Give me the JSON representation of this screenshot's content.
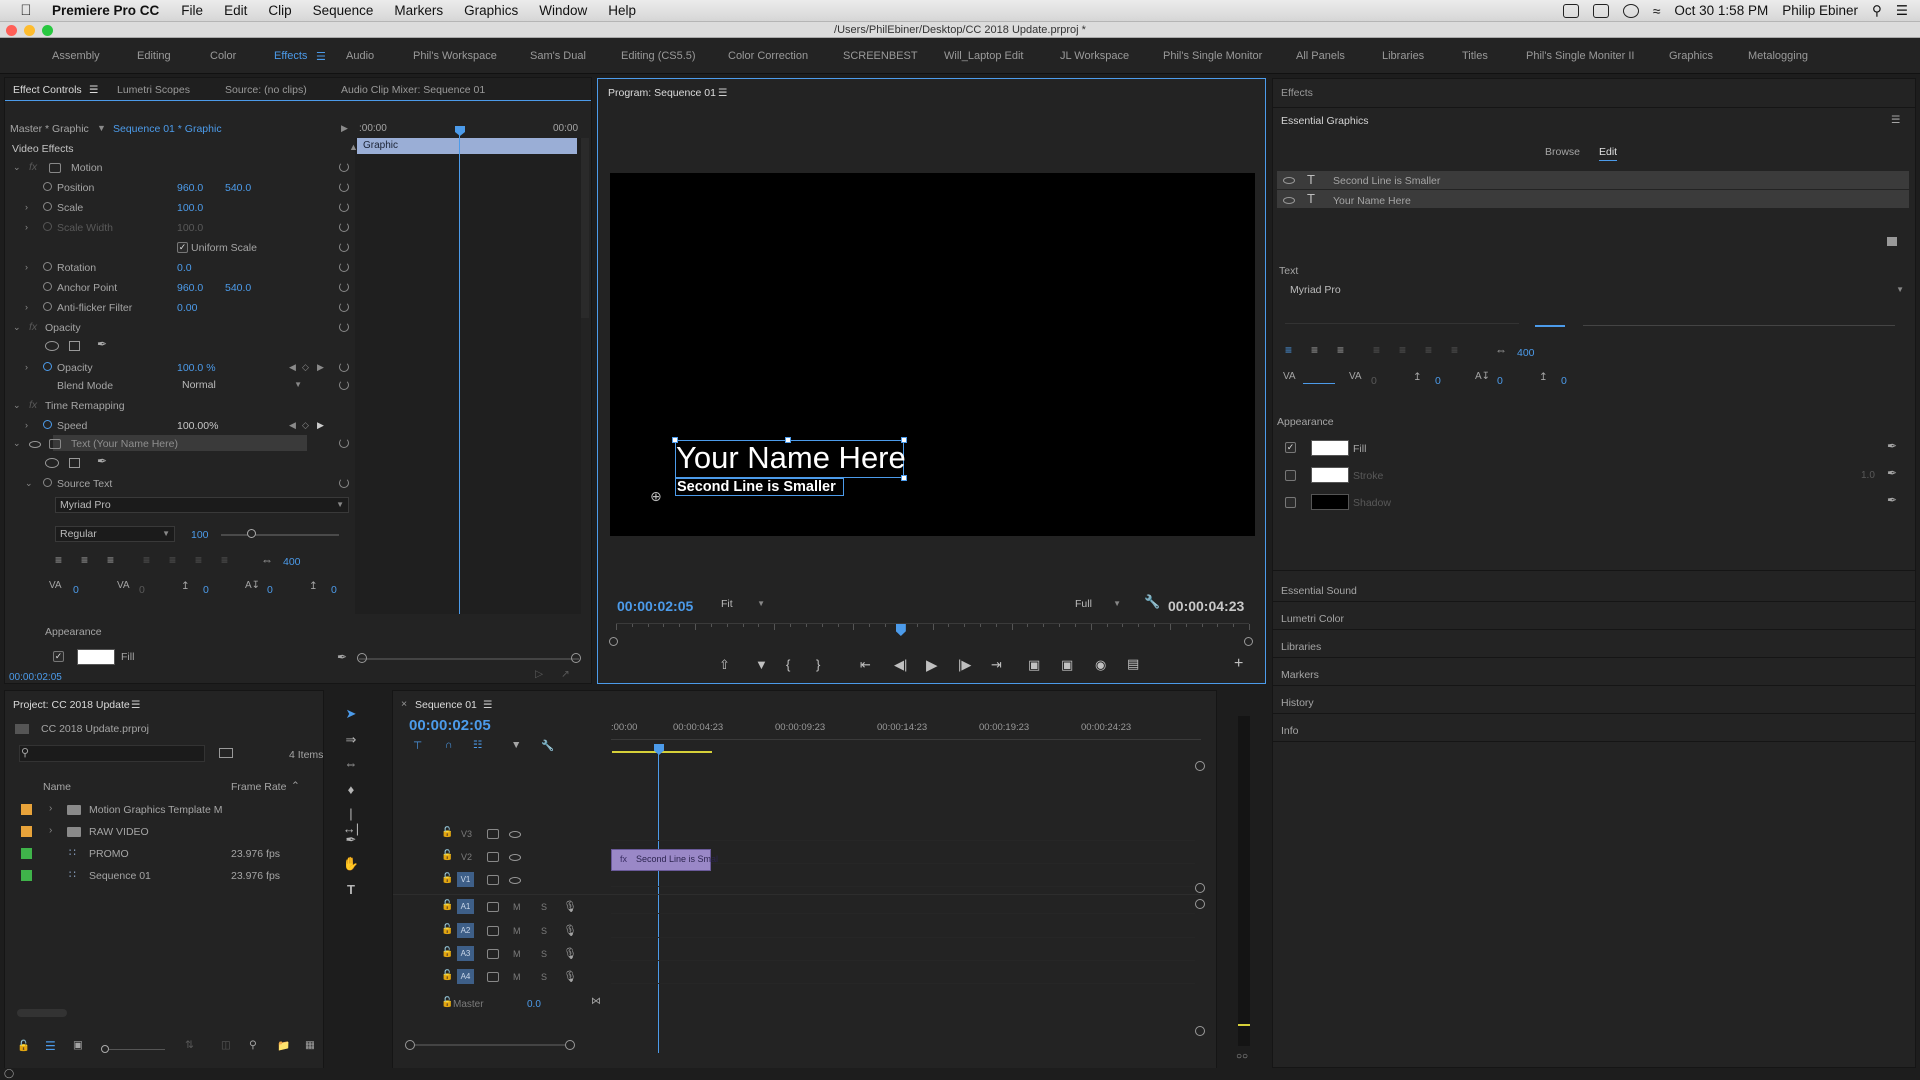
{
  "menubar": {
    "app": "Premiere Pro CC",
    "menus": [
      "File",
      "Edit",
      "Clip",
      "Sequence",
      "Markers",
      "Graphics",
      "Window",
      "Help"
    ],
    "datetime": "Oct 30  1:58 PM",
    "user": "Philip Ebiner"
  },
  "window_title": "/Users/PhilEbiner/Desktop/CC 2018 Update.prproj *",
  "workspaces": [
    "Assembly",
    "Editing",
    "Color",
    "Effects",
    "Audio",
    "Phil's Workspace",
    "Sam's Dual",
    "Editing (CS5.5)",
    "Color Correction",
    "SCREENBEST",
    "Will_Laptop Edit",
    "JL Workspace",
    "Phil's Single Monitor",
    "All Panels",
    "Libraries",
    "Titles",
    "Phil's Single Moniter II",
    "Graphics",
    "Metalogging"
  ],
  "active_workspace": "Effects",
  "effect_controls": {
    "tabs": [
      "Effect Controls",
      "Lumetri Scopes",
      "Source: (no clips)",
      "Audio Clip Mixer: Sequence 01"
    ],
    "master": "Master * Graphic",
    "sequence": "Sequence 01 * Graphic",
    "time_start": ":00:00",
    "time_end": "00:00",
    "clip_label": "Graphic",
    "video_effects": "Video Effects",
    "motion": "Motion",
    "position_label": "Position",
    "position_x": "960.0",
    "position_y": "540.0",
    "scale_label": "Scale",
    "scale": "100.0",
    "scale_width_label": "Scale Width",
    "scale_width": "100.0",
    "uniform_scale": "Uniform Scale",
    "rotation_label": "Rotation",
    "rotation": "0.0",
    "anchor_label": "Anchor Point",
    "anchor_x": "960.0",
    "anchor_y": "540.0",
    "antiflicker_label": "Anti-flicker Filter",
    "antiflicker": "0.00",
    "opacity_group": "Opacity",
    "opacity_label": "Opacity",
    "opacity": "100.0 %",
    "blend_label": "Blend Mode",
    "blend": "Normal",
    "time_remap": "Time Remapping",
    "speed_label": "Speed",
    "speed": "100.00%",
    "text_layer": "Text (Your Name Here)",
    "source_text": "Source Text",
    "font": "Myriad Pro",
    "font_style": "Regular",
    "font_size": "100",
    "tracking_val": "400",
    "kerning_vals": [
      "0",
      "0",
      "0",
      "0",
      "0"
    ],
    "appearance": "Appearance",
    "fill": "Fill",
    "timecode": "00:00:02:05"
  },
  "program_monitor": {
    "title": "Program: Sequence 01",
    "title_line1": "Your Name Here",
    "title_line2": "Second Line is Smaller",
    "timecode": "00:00:02:05",
    "fit": "Fit",
    "quality": "Full",
    "duration": "00:00:04:23",
    "playhead_fraction": 0.45
  },
  "essential_graphics": {
    "effects_tab": "Effects",
    "title": "Essential Graphics",
    "browse": "Browse",
    "edit": "Edit",
    "layers": [
      "Second Line is Smaller",
      "Your Name Here"
    ],
    "text_section": "Text",
    "font": "Myriad Pro",
    "tracking": "400",
    "kerning_vals": [
      "0",
      "0",
      "0",
      "0"
    ],
    "appearance": "Appearance",
    "fill": "Fill",
    "stroke": "Stroke",
    "stroke_width": "1.0",
    "shadow": "Shadow",
    "collapsed_panels": [
      "Essential Sound",
      "Lumetri Color",
      "Libraries",
      "Markers",
      "History",
      "Info"
    ]
  },
  "project": {
    "title": "Project: CC 2018 Update",
    "file": "CC 2018 Update.prproj",
    "items_count": "4 Items",
    "col_name": "Name",
    "col_fps": "Frame Rate",
    "items": [
      {
        "name": "Motion Graphics Template M",
        "fps": "",
        "color": "#e8a33a",
        "type": "folder"
      },
      {
        "name": "RAW VIDEO",
        "fps": "",
        "color": "#e8a33a",
        "type": "folder"
      },
      {
        "name": "PROMO",
        "fps": "23.976 fps",
        "color": "#3fb34a",
        "type": "seq"
      },
      {
        "name": "Sequence 01",
        "fps": "23.976 fps",
        "color": "#3fb34a",
        "type": "seq"
      }
    ]
  },
  "timeline": {
    "tab": "Sequence 01",
    "timecode": "00:00:02:05",
    "ruler": [
      ":00:00",
      "00:00:04:23",
      "00:00:09:23",
      "00:00:14:23",
      "00:00:19:23",
      "00:00:24:23"
    ],
    "video_tracks": [
      "V3",
      "V2",
      "V1"
    ],
    "audio_tracks": [
      "A1",
      "A2",
      "A3",
      "A4"
    ],
    "track_m": "M",
    "track_s": "S",
    "master": "Master",
    "master_val": "0.0",
    "clip": "Second Line is Smal"
  },
  "colors": {
    "accent": "#4c9bea",
    "panel": "#232323",
    "bg": "#1d1d1d"
  }
}
